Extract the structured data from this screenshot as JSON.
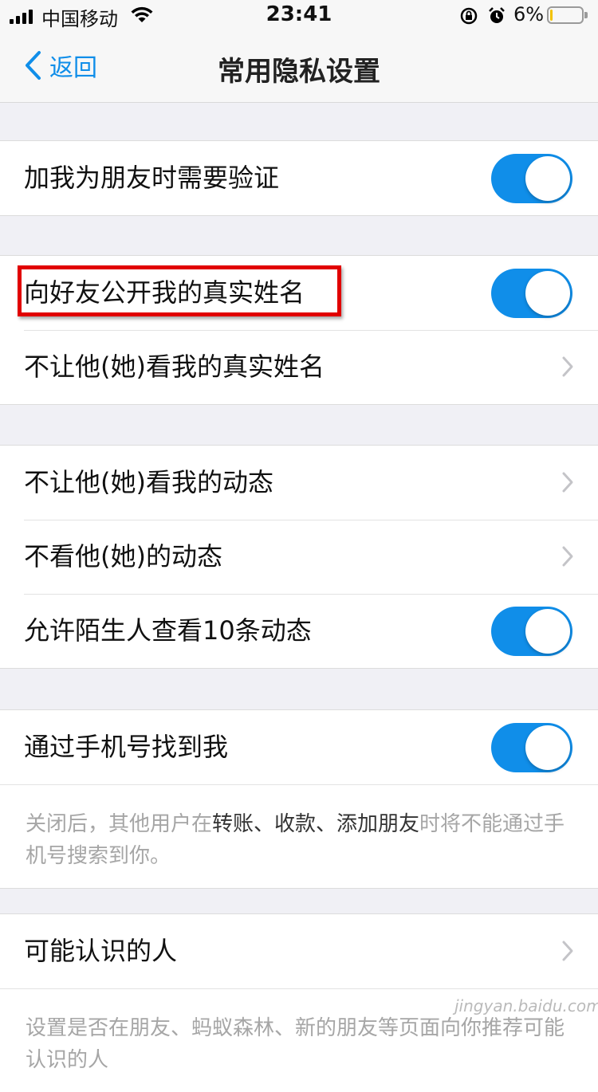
{
  "status_bar": {
    "carrier": "中国移动",
    "time": "23:41",
    "battery_percent": "6%",
    "battery_level": 0.06,
    "battery_color": "#f2c200"
  },
  "nav": {
    "back_label": "返回",
    "title": "常用隐私设置"
  },
  "accent_color": "#108ee9",
  "groups": [
    {
      "items": [
        {
          "label": "加我为朋友时需要验证",
          "control": "toggle",
          "on": true
        }
      ]
    },
    {
      "items": [
        {
          "label": "向好友公开我的真实姓名",
          "control": "toggle",
          "on": true,
          "highlighted": true
        },
        {
          "label": "不让他(她)看我的真实姓名",
          "control": "chevron"
        }
      ]
    },
    {
      "items": [
        {
          "label": "不让他(她)看我的动态",
          "control": "chevron"
        },
        {
          "label": "不看他(她)的动态",
          "control": "chevron"
        },
        {
          "label": "允许陌生人查看10条动态",
          "control": "toggle",
          "on": true
        }
      ]
    },
    {
      "items": [
        {
          "label": "通过手机号找到我",
          "control": "toggle",
          "on": true
        }
      ],
      "note": {
        "prefix": "关闭后，其他用户在",
        "emphasis": "转账、收款、添加朋友",
        "suffix": "时将不能通过手机号搜索到你。"
      }
    },
    {
      "items": [
        {
          "label": "可能认识的人",
          "control": "chevron"
        }
      ],
      "note": {
        "text": "设置是否在朋友、蚂蚁森林、新的朋友等页面向你推荐可能认识的人"
      }
    }
  ],
  "watermark": "jingyan.baidu.com"
}
